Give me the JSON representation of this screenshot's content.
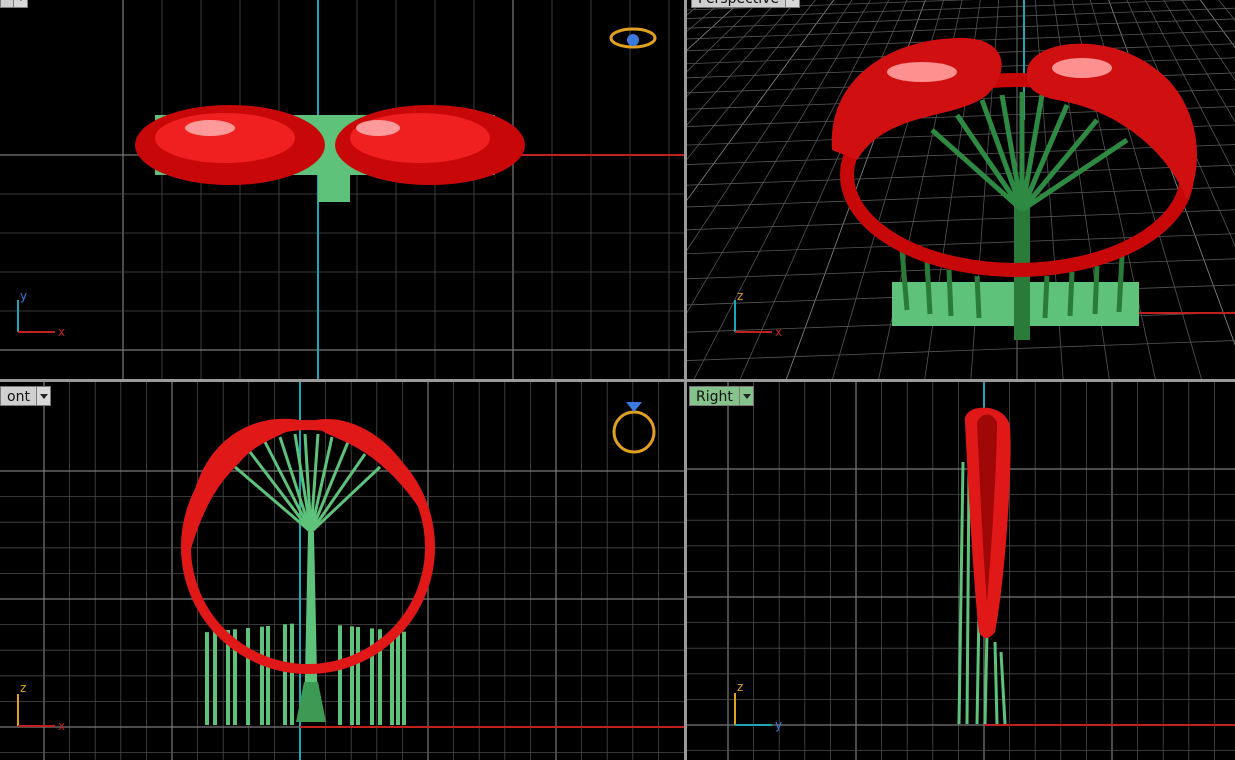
{
  "viewports": {
    "top": {
      "label": ""
    },
    "perspective": {
      "label": "Perspective"
    },
    "front": {
      "label": "ont"
    },
    "right": {
      "label": "Right"
    }
  },
  "axes": {
    "top": {
      "a": "y",
      "b": "x"
    },
    "perspective": {
      "a": "z",
      "b": "x"
    },
    "front": {
      "a": "z",
      "b": "x"
    },
    "right": {
      "a": "z",
      "b": "y"
    }
  },
  "colors": {
    "viewport_bg": "#000000",
    "grid": "#4a4a4a",
    "grid_major": "#7a7a7a",
    "x_axis": "#c0211f",
    "y_axis": "#1ba7b3",
    "model_red": "#e01010",
    "support_green": "#5ec27a",
    "active_tab": "#86c28b",
    "ring_icon": "#e0a020"
  },
  "icons": [
    "ring-gumball-icon",
    "ring-view-icon"
  ]
}
